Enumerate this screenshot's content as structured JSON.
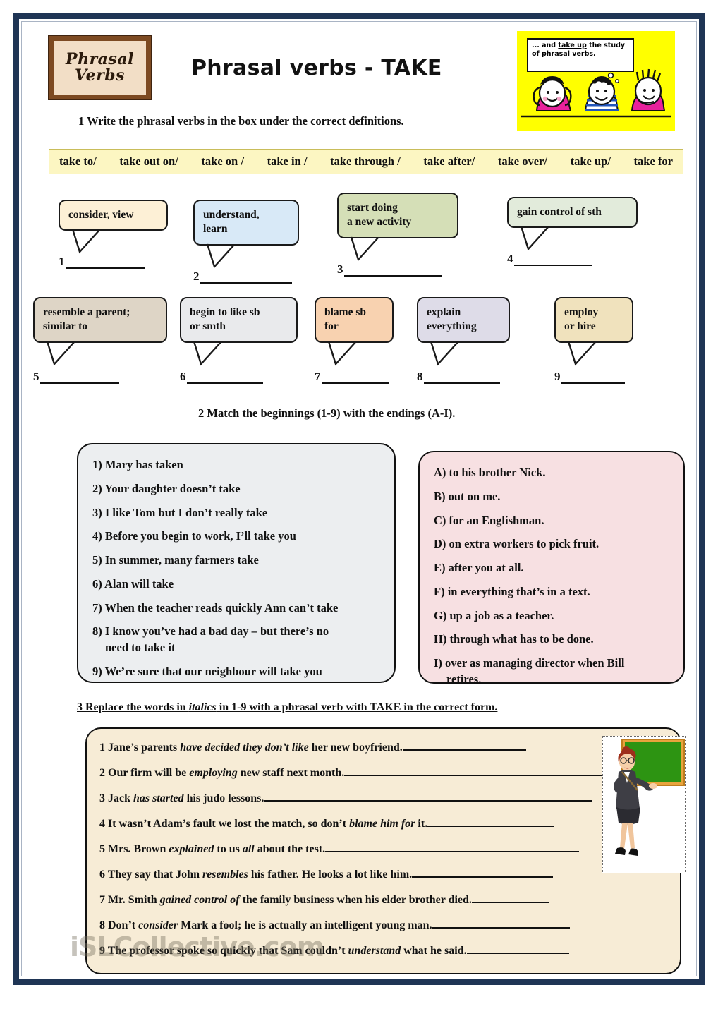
{
  "page": {
    "logo_line1": "Phrasal",
    "logo_line2": "Verbs",
    "title": "Phrasal verbs - TAKE",
    "watermark": "iSLCollective.com",
    "border_color": "#1f3555",
    "accent_yellow": "#ffff00"
  },
  "cartoon": {
    "bubble_text_pre": "... and ",
    "bubble_text_underlined": "take up",
    "bubble_text_post": " the study of phrasal verbs.",
    "background": "#ffff00"
  },
  "exercise1": {
    "instruction": "1 Write the phrasal verbs in the box under the correct definitions.",
    "verb_bank": [
      "take to/",
      "take out on/",
      "take on /",
      "take in /",
      "take through /",
      "take after/",
      "take over/",
      "take up/",
      "take for"
    ],
    "definitions": [
      {
        "number": "1",
        "text": "consider, view",
        "color": "#fdf0d6",
        "row": 1
      },
      {
        "number": "2",
        "text": "understand,\nlearn",
        "color": "#d8e9f7",
        "row": 1
      },
      {
        "number": "3",
        "text": "start doing\na new activity",
        "color": "#d5dfb7",
        "row": 1
      },
      {
        "number": "4",
        "text": "gain control of sth",
        "color": "#e2ebdb",
        "row": 1
      },
      {
        "number": "5",
        "text": "resemble a parent;\nsimilar to",
        "color": "#ded5c6",
        "row": 2
      },
      {
        "number": "6",
        "text": "begin to like sb\nor smth",
        "color": "#e9eaec",
        "row": 2
      },
      {
        "number": "7",
        "text": "blame sb\nfor",
        "color": "#f8d2b0",
        "row": 2
      },
      {
        "number": "8",
        "text": "explain\neverything",
        "color": "#dedce8",
        "row": 2
      },
      {
        "number": "9",
        "text": "employ\nor hire",
        "color": "#f0e2bd",
        "row": 2
      }
    ]
  },
  "exercise2": {
    "instruction": "2 Match the beginnings (1-9) with the endings (A-I).",
    "left_panel_color": "#eceef0",
    "right_panel_color": "#f7e0e2",
    "beginnings": [
      {
        "label": "1)",
        "text": "Mary has taken"
      },
      {
        "label": "2)",
        "text": "Your daughter doesn’t take"
      },
      {
        "label": "3)",
        "text": "I like Tom but I don’t really take"
      },
      {
        "label": "4)",
        "text": "Before you begin to work, I’ll take you"
      },
      {
        "label": "5)",
        "text": "In summer, many farmers take"
      },
      {
        "label": "6)",
        "text": "Alan will take"
      },
      {
        "label": "7)",
        "text": "When the teacher reads quickly Ann can’t take"
      },
      {
        "label": "8)",
        "text": "I know you’ve had a bad day – but there’s no",
        "cont": "need to take it"
      },
      {
        "label": "9)",
        "text": "We’re sure that our neighbour will take you"
      }
    ],
    "endings": [
      {
        "label": "A)",
        "text": "to his brother Nick."
      },
      {
        "label": "B)",
        "text": "out on me."
      },
      {
        "label": "C)",
        "text": "for an Englishman."
      },
      {
        "label": "D)",
        "text": "on extra workers to pick fruit."
      },
      {
        "label": "E)",
        "text": "after you at all."
      },
      {
        "label": "F)",
        "text": "in everything that’s in a text."
      },
      {
        "label": "G)",
        "text": "up a job as a teacher."
      },
      {
        "label": "H)",
        "text": "through what has to be done."
      },
      {
        "label": "I)",
        "text": "over as managing director when Bill",
        "cont": "retires."
      }
    ]
  },
  "exercise3": {
    "instruction_pre": "3 Replace the words in ",
    "instruction_italic": "italics",
    "instruction_post": " in 1-9 with a phrasal verb with TAKE in the correct form.",
    "panel_color": "#f7ecd6",
    "sentences": [
      {
        "number": "1",
        "pre": "Jane’s parents ",
        "italic": "have decided they don’t like",
        "post": " her new boyfriend.",
        "fill_width": 175
      },
      {
        "number": "2",
        "pre": "Our firm will be ",
        "italic": "employing",
        "post": " new staff next month.",
        "fill_width": 370
      },
      {
        "number": "3",
        "pre": "Jack ",
        "italic": "has started",
        "post": " his judo lessons.",
        "fill_width": 465
      },
      {
        "number": "4",
        "pre": "It wasn’t Adam’s fault we lost the match, so don’t ",
        "italic": "blame him for",
        "post": " it.",
        "fill_width": 180
      },
      {
        "number": "5",
        "pre": "Mrs. Brown ",
        "italic": "explained",
        "post": " to us ",
        "italic2": "all",
        "post2": " about the test.",
        "fill_width": 360
      },
      {
        "number": "6",
        "pre": "They say that John ",
        "italic": "resembles",
        "post": " his father. He looks a lot like him.",
        "fill_width": 200
      },
      {
        "number": "7",
        "pre": "Mr. Smith ",
        "italic": "gained control of",
        "post": " the family business when his elder brother died.",
        "fill_width": 110
      },
      {
        "number": "8",
        "pre": "Don’t ",
        "italic": "consider",
        "post": " Mark a fool; he is actually an intelligent young man.",
        "fill_width": 195
      },
      {
        "number": "9",
        "pre": "The professor spoke so quickly that Sam couldn’t ",
        "italic": "understand",
        "post": " what he said.",
        "fill_width": 145
      }
    ]
  }
}
